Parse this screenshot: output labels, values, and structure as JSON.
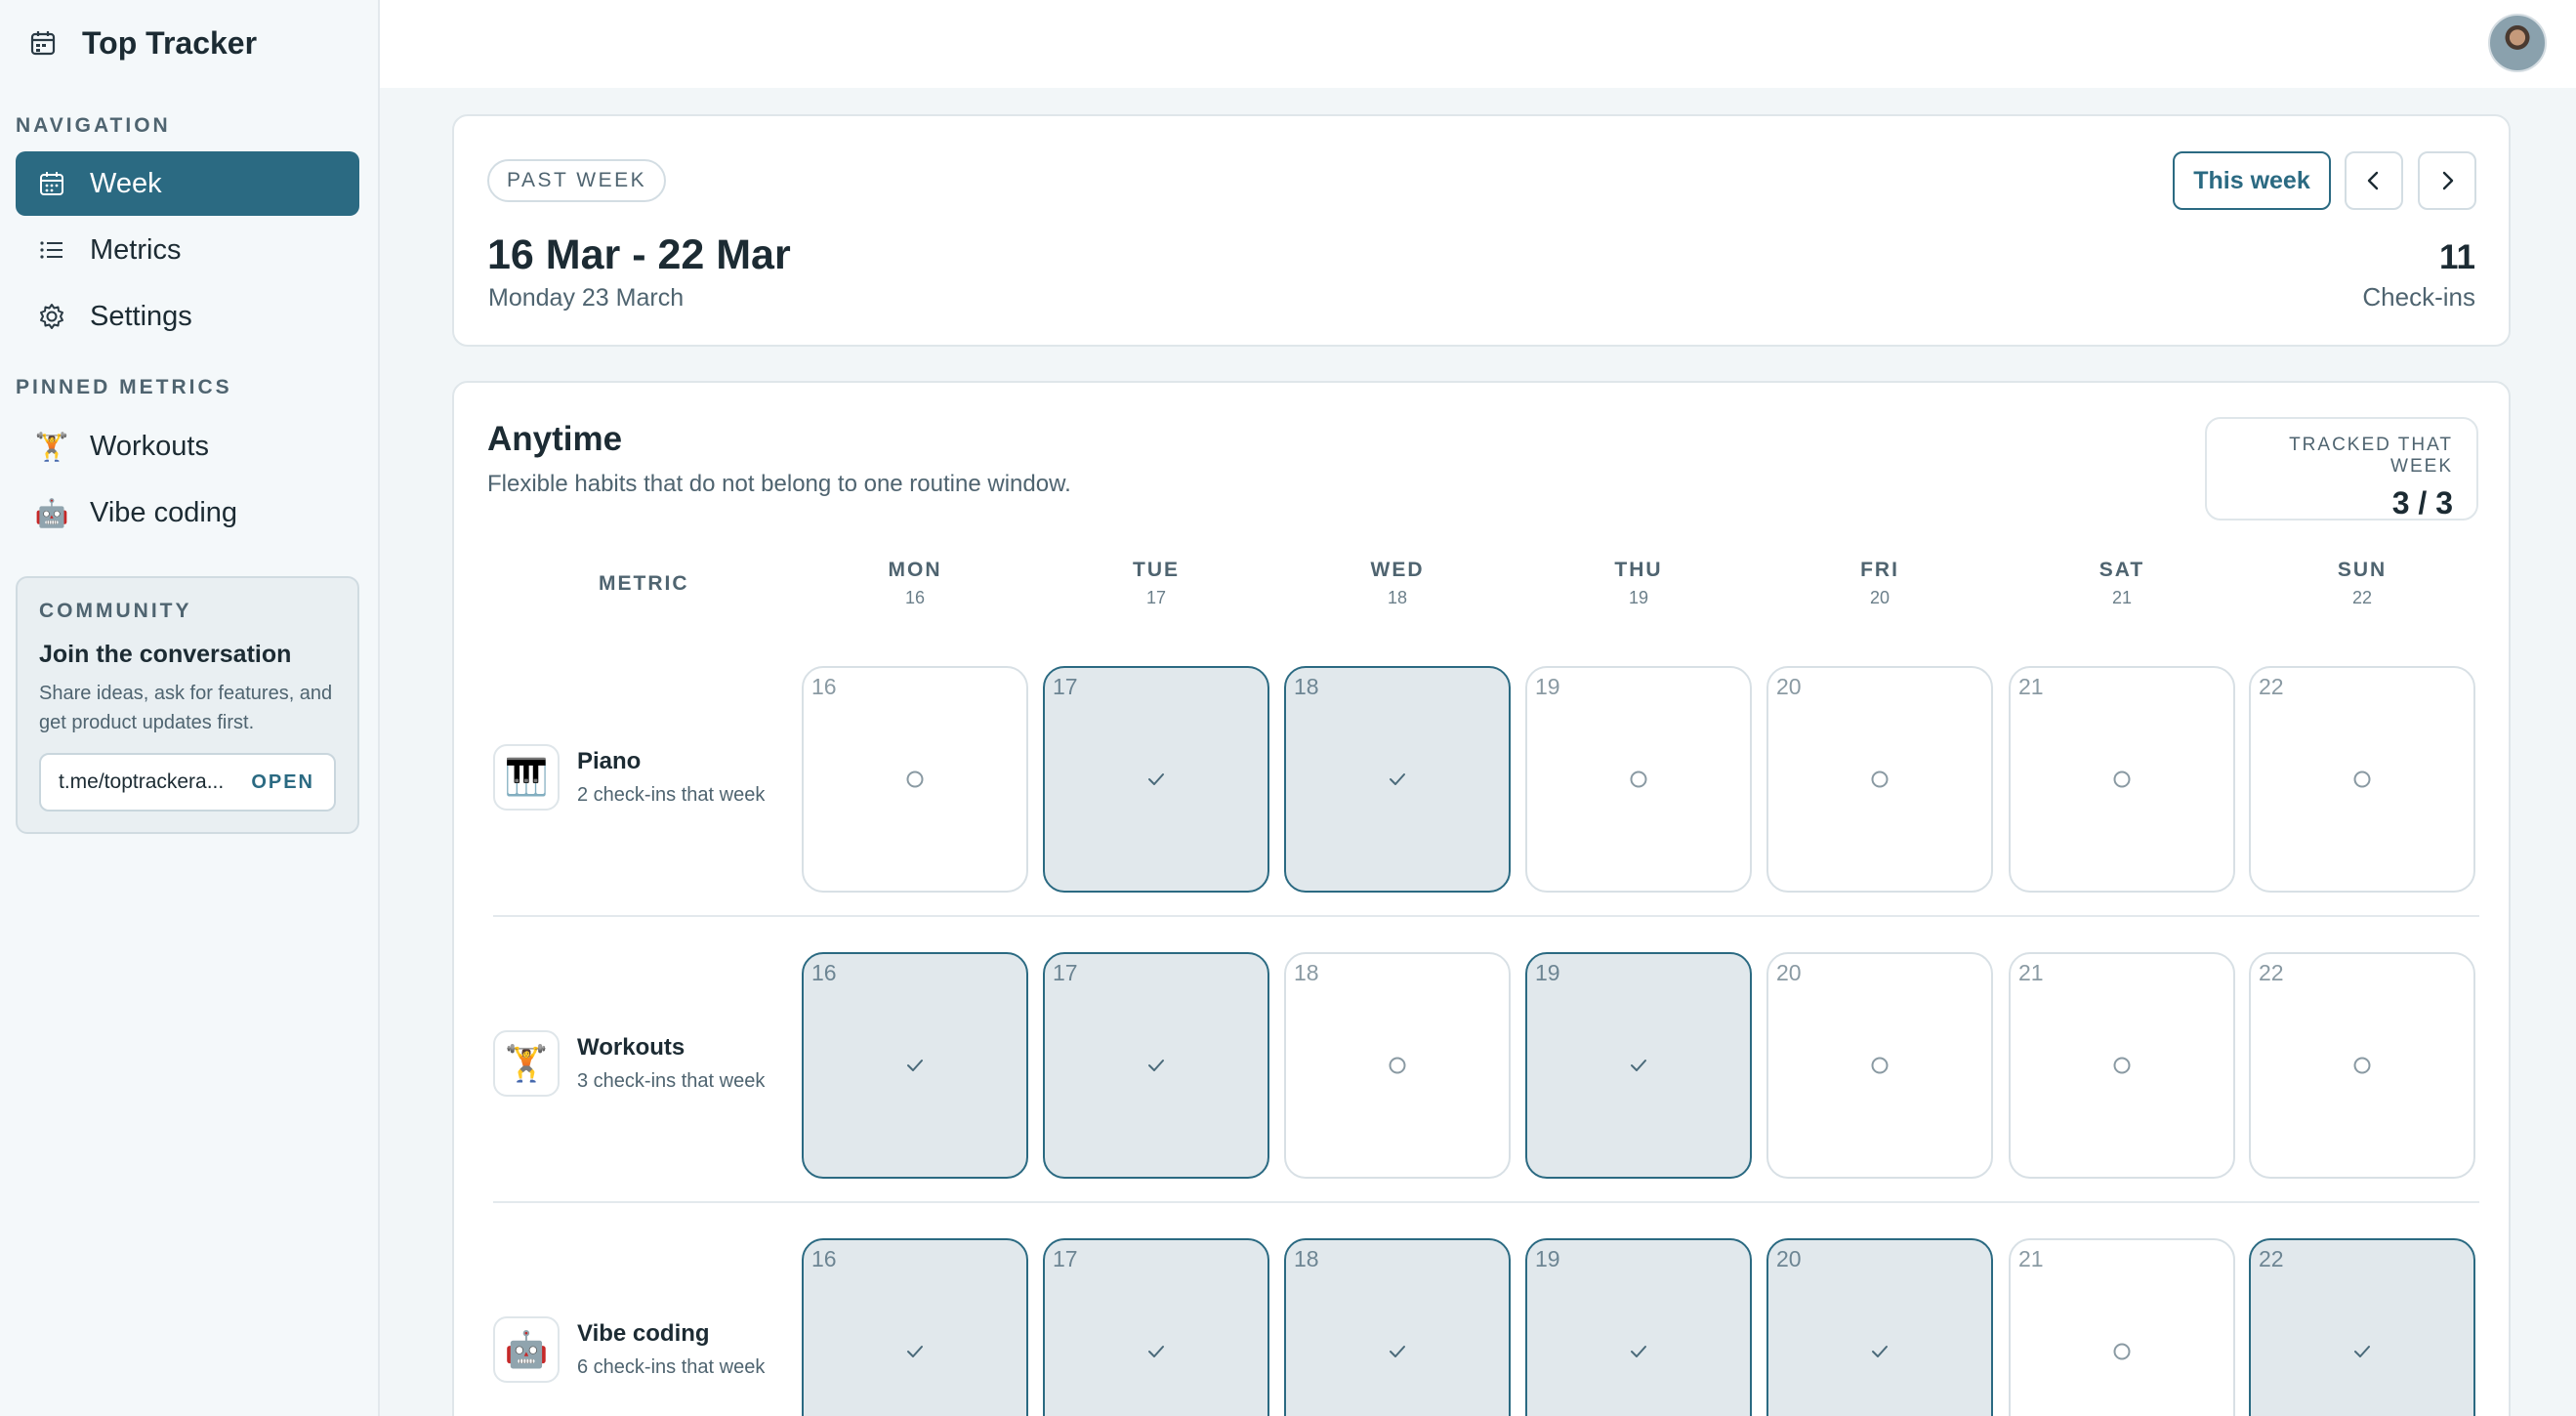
{
  "app": {
    "title": "Top Tracker"
  },
  "sidebar": {
    "nav_label": "NAVIGATION",
    "nav": [
      {
        "label": "Week",
        "icon": "calendar-icon",
        "active": true
      },
      {
        "label": "Metrics",
        "icon": "list-icon",
        "active": false
      },
      {
        "label": "Settings",
        "icon": "gear-icon",
        "active": false
      }
    ],
    "pinned_label": "PINNED METRICS",
    "pinned": [
      {
        "label": "Workouts",
        "emoji": "🏋️"
      },
      {
        "label": "Vibe coding",
        "emoji": "🤖"
      }
    ],
    "community": {
      "label": "COMMUNITY",
      "title": "Join the conversation",
      "desc": "Share ideas, ask for features, and get product updates first.",
      "link": "t.me/toptrackera...",
      "open": "OPEN"
    }
  },
  "week": {
    "pill": "PAST WEEK",
    "range": "16 Mar - 22 Mar",
    "today": "Monday 23 March",
    "this_week": "This week",
    "checkins_count": "11",
    "checkins_label": "Check-ins"
  },
  "anytime": {
    "title": "Anytime",
    "desc": "Flexible habits that do not belong to one routine window.",
    "tracked_label": "TRACKED THAT WEEK",
    "tracked_value": "3 / 3",
    "metric_header": "METRIC",
    "days": [
      {
        "name": "MON",
        "date": "16"
      },
      {
        "name": "TUE",
        "date": "17"
      },
      {
        "name": "WED",
        "date": "18"
      },
      {
        "name": "THU",
        "date": "19"
      },
      {
        "name": "FRI",
        "date": "20"
      },
      {
        "name": "SAT",
        "date": "21"
      },
      {
        "name": "SUN",
        "date": "22"
      }
    ],
    "rows": [
      {
        "name": "Piano",
        "sub": "2 check-ins that week",
        "emoji": "🎹",
        "done": [
          false,
          true,
          true,
          false,
          false,
          false,
          false
        ]
      },
      {
        "name": "Workouts",
        "sub": "3 check-ins that week",
        "emoji": "🏋️",
        "done": [
          true,
          true,
          false,
          true,
          false,
          false,
          false
        ]
      },
      {
        "name": "Vibe coding",
        "sub": "6 check-ins that week",
        "emoji": "🤖",
        "done": [
          true,
          true,
          true,
          true,
          true,
          false,
          true
        ]
      }
    ]
  },
  "colors": {
    "accent": "#2b6a82",
    "done_bg": "#e1e8ec",
    "muted": "#4f6470"
  }
}
